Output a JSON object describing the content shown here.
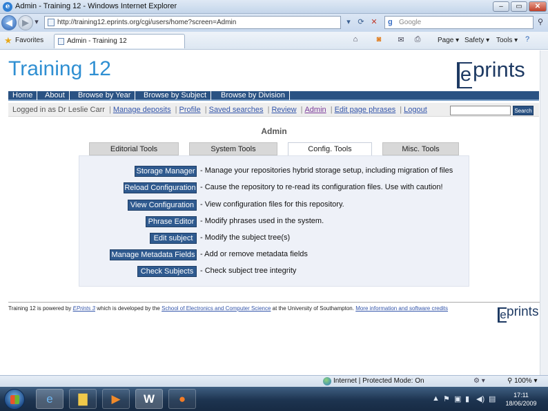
{
  "window": {
    "title": "Admin - Training 12 - Windows Internet Explorer",
    "address": "http://training12.eprints.org/cgi/users/home?screen=Admin",
    "search_placeholder": "Google",
    "tab_title": "Admin - Training 12",
    "favorites_label": "Favorites",
    "commands": {
      "page": "Page",
      "safety": "Safety",
      "tools": "Tools"
    }
  },
  "site": {
    "title": "Training 12",
    "logo_text": "prints",
    "logo_letter": "e"
  },
  "menu": [
    "Home",
    "About",
    "Browse by Year",
    "Browse by Subject",
    "Browse by Division"
  ],
  "login": {
    "prefix": "Logged in as Dr Leslie Carr",
    "links": [
      "Manage deposits",
      "Profile",
      "Saved searches",
      "Review",
      "Admin",
      "Edit page phrases",
      "Logout"
    ],
    "search_button": "Search"
  },
  "admin": {
    "heading": "Admin",
    "tabs": [
      "Editorial Tools",
      "System Tools",
      "Config. Tools",
      "Misc. Tools"
    ],
    "selected_tab": "Config. Tools",
    "actions": [
      {
        "button": "Storage Manager",
        "description": "- Manage your repositories hybrid storage setup, including migration of files"
      },
      {
        "button": "Reload Configuration",
        "description": "- Cause the repository to re-read its configuration files. Use with caution!"
      },
      {
        "button": "View Configuration",
        "description": "- View configuration files for this repository."
      },
      {
        "button": "Phrase Editor",
        "description": "- Modify phrases used in the system."
      },
      {
        "button": "Edit subject",
        "description": "- Modify the subject tree(s)"
      },
      {
        "button": "Manage Metadata Fields",
        "description": "- Add or remove metadata fields"
      },
      {
        "button": "Check Subjects",
        "description": "- Check subject tree integrity"
      }
    ]
  },
  "footer": {
    "t1": "Training 12 is powered by",
    "eprints_link": "EPrints 3",
    "t2": "which is developed by the",
    "school_link": "School of Electronics and Computer Science",
    "t3": "at the University of Southampton.",
    "credits_link": "More information and software credits",
    "logo_text": "prints",
    "logo_letter": "e"
  },
  "status": {
    "zone": "Internet | Protected Mode: On",
    "zoom": "100%"
  },
  "taskbar": {
    "time": "17:11",
    "date": "18/06/2009"
  },
  "colors": {
    "title_blue": "#2f8fd2",
    "menu_blue": "#2a5283",
    "button_blue": "#2f5a8f",
    "panel_bg": "#eef1f8"
  }
}
